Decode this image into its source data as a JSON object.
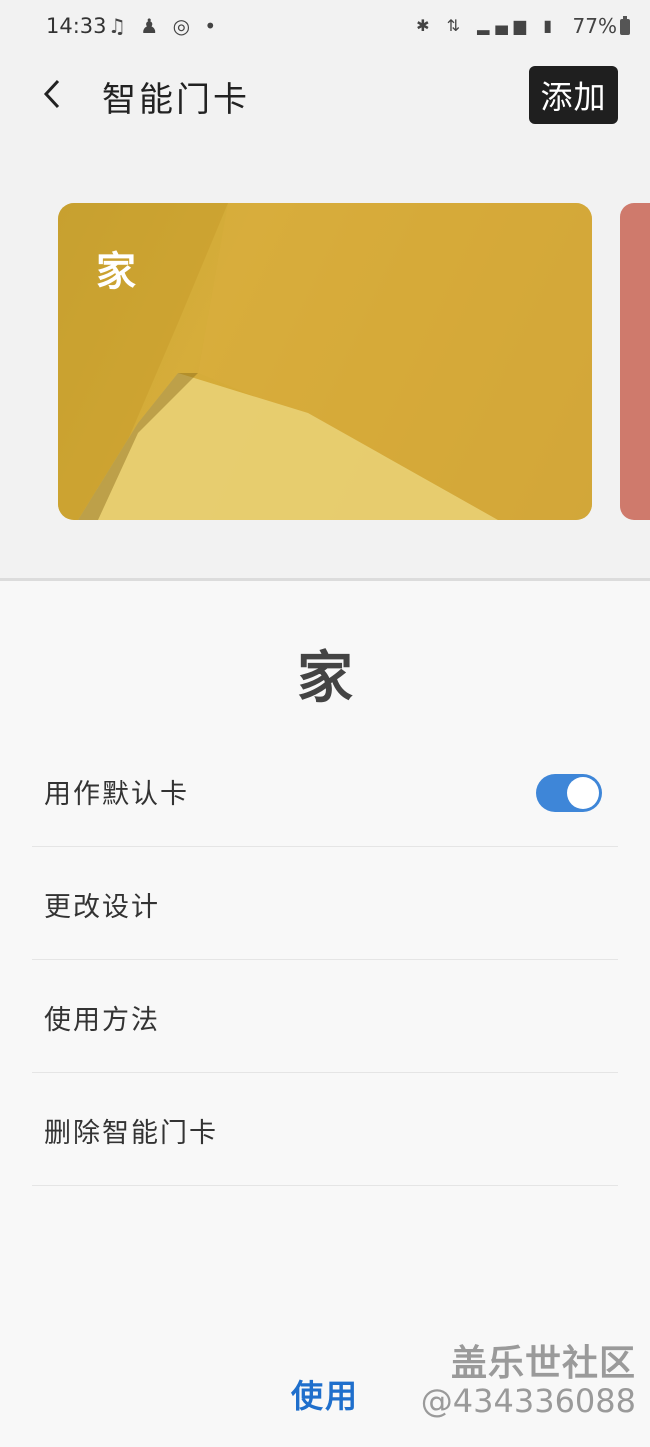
{
  "status_bar": {
    "time": "14:33",
    "left_icons": [
      "music-note-icon",
      "shield-person-icon",
      "weibo-icon",
      "dot-icon"
    ],
    "right_icons": [
      "bluetooth-icon",
      "data-arrows-icon",
      "signal-icon",
      "3g-icon"
    ],
    "battery": "77%"
  },
  "header": {
    "title": "智能门卡",
    "add_label": "添加"
  },
  "cards": [
    {
      "label": "家",
      "color": "#d4aa38"
    },
    {
      "label": "",
      "color": "#cf7a6c"
    }
  ],
  "sheet": {
    "title": "家",
    "rows": [
      {
        "label": "用作默认卡",
        "toggle_on": true
      },
      {
        "label": "更改设计"
      },
      {
        "label": "使用方法"
      },
      {
        "label": "删除智能门卡"
      }
    ],
    "use_label": "使用"
  },
  "watermark": {
    "name": "盖乐世社区",
    "id": "@434336088"
  },
  "colors": {
    "toggle_accent": "#3e86d8",
    "use_button": "#1f6fcc"
  }
}
